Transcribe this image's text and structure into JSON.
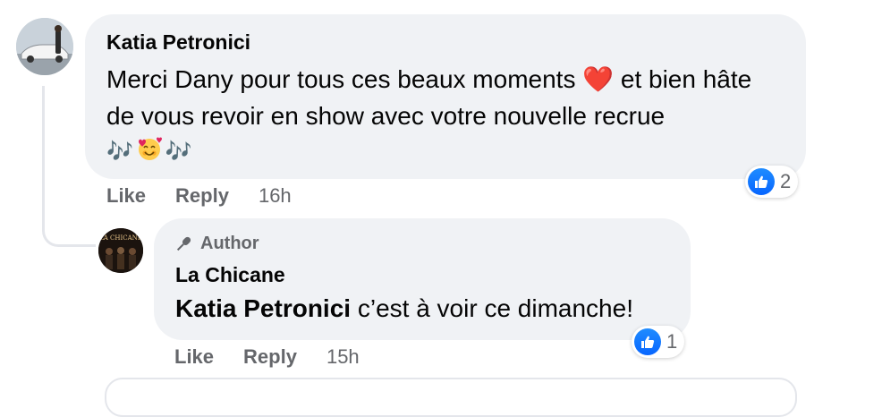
{
  "comment": {
    "author": "Katia Petronici",
    "text": "Merci Dany pour tous ces beaux moments ❤️ et bien hâte de vous revoir en show avec votre nouvelle recrue",
    "emoji_line": [
      "🎶",
      "🥰",
      "🎶"
    ],
    "actions": {
      "like": "Like",
      "reply": "Reply",
      "time": "16h"
    },
    "reaction": {
      "icon": "like-thumb-icon",
      "count": "2"
    }
  },
  "reply": {
    "badge": "Author",
    "author": "La Chicane",
    "mention": "Katia Petronici",
    "text": " c’est à voir ce dimanche!",
    "avatar_text": "LA CHICANE",
    "actions": {
      "like": "Like",
      "reply": "Reply",
      "time": "15h"
    },
    "reaction": {
      "icon": "like-thumb-icon",
      "count": "1"
    }
  },
  "colors": {
    "bubble": "#f0f2f5",
    "secondary_text": "#65676b",
    "like_blue": "#0866ff",
    "heart_red": "#e0245e"
  }
}
